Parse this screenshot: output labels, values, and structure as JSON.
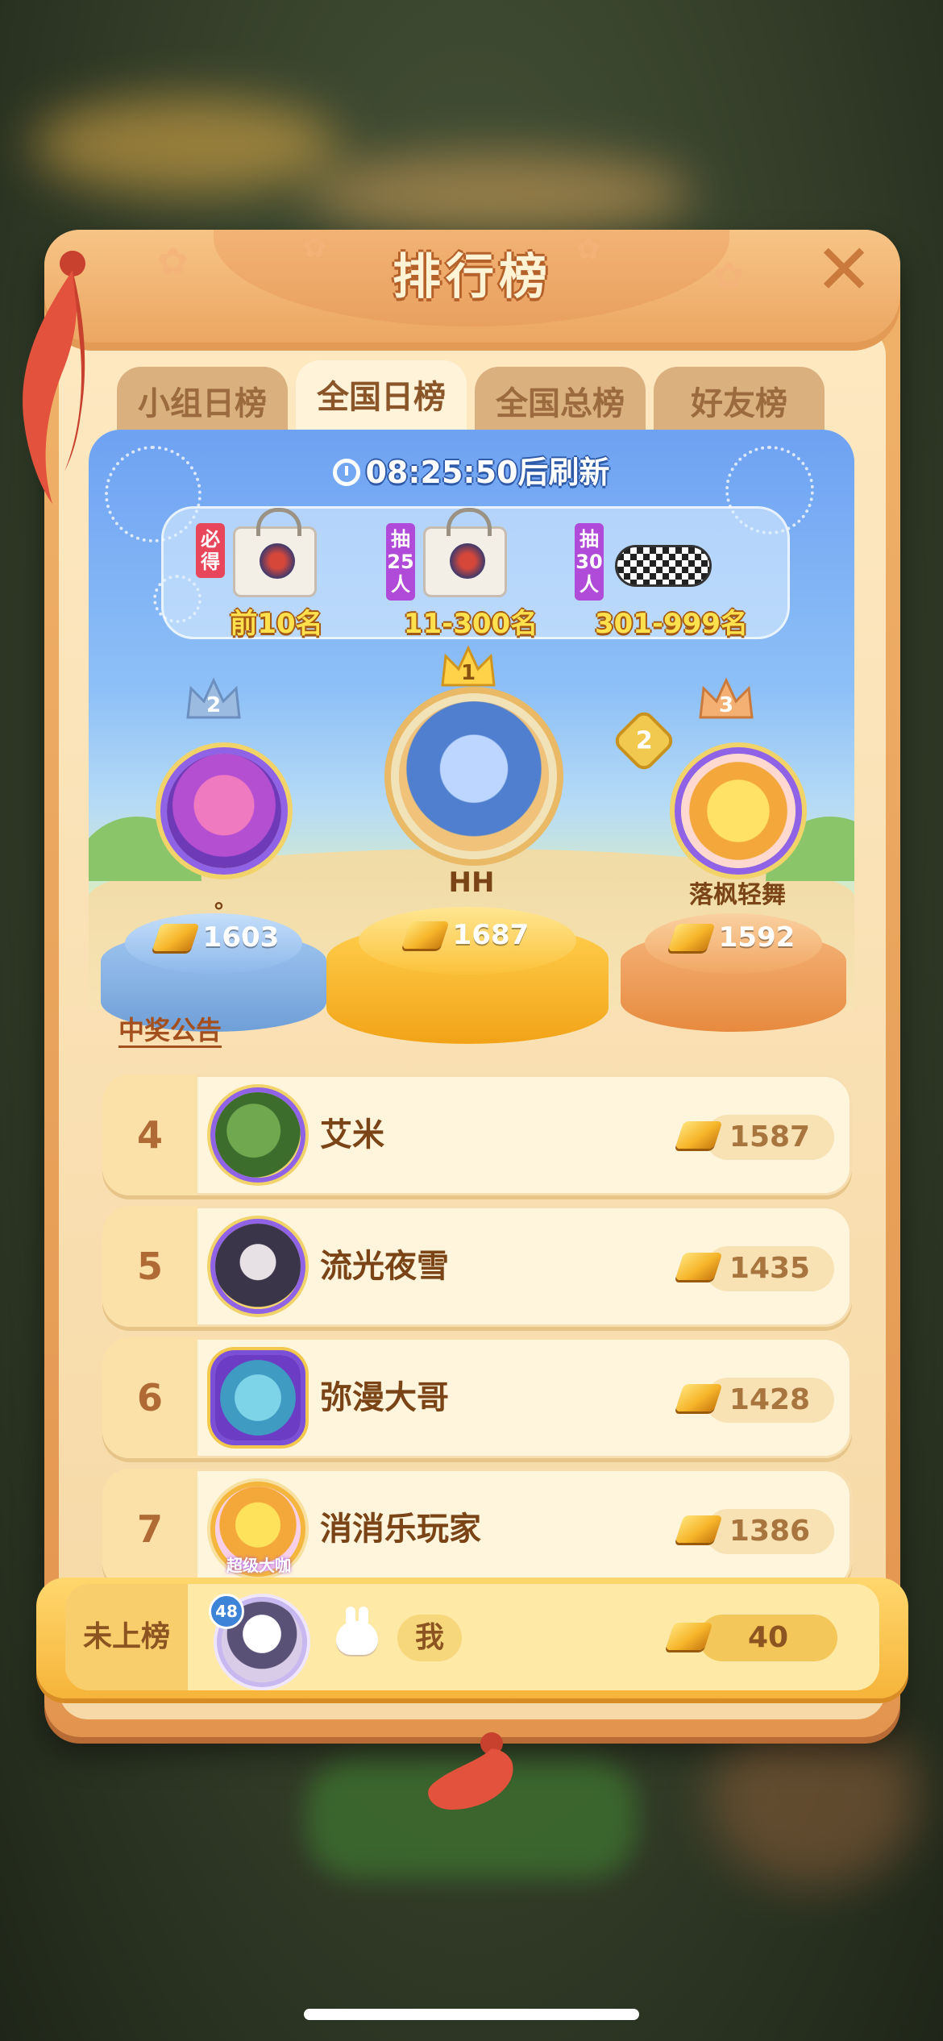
{
  "panel": {
    "title": "排行榜",
    "close_icon": "close-icon"
  },
  "tabs": [
    {
      "label": "小组日榜",
      "active": false
    },
    {
      "label": "全国日榜",
      "active": true
    },
    {
      "label": "全国总榜",
      "active": false
    },
    {
      "label": "好友榜",
      "active": false
    }
  ],
  "refresh": {
    "countdown": "08:25:50",
    "suffix": "后刷新"
  },
  "prizes": [
    {
      "tag": "必得",
      "range": "前10名",
      "item": "tote-bag",
      "tag_color": "#e8475b"
    },
    {
      "tag": "抽25人",
      "range": "11-300名",
      "item": "tote-bag",
      "tag_color": "#b04ad8"
    },
    {
      "tag": "抽30人",
      "range": "301-999名",
      "item": "checkered-belt-bag",
      "tag_color": "#b04ad8"
    }
  ],
  "podium": [
    {
      "rank": "1",
      "name": "HH",
      "score": "1687",
      "color": "#f5b42c"
    },
    {
      "rank": "2",
      "name": "。",
      "score": "1603",
      "color": "#7fb2e8"
    },
    {
      "rank": "3",
      "name": "落枫轻舞",
      "score": "1592",
      "color": "#f0a55c",
      "level_badge": "2"
    }
  ],
  "announcement": "中奖公告",
  "list": [
    {
      "rank": "4",
      "name": "艾米",
      "score": "1587"
    },
    {
      "rank": "5",
      "name": "流光夜雪",
      "score": "1435"
    },
    {
      "rank": "6",
      "name": "弥漫大哥",
      "score": "1428"
    },
    {
      "rank": "7",
      "name": "消消乐玩家",
      "score": "1386",
      "avatar_caption": "超级大咖"
    }
  ],
  "self": {
    "rank": "未上榜",
    "level": "48",
    "name": "我",
    "score": "40"
  },
  "colors": {
    "panel_orange": "#e3954f",
    "gold": "#f6b52a",
    "brown_text": "#7a4416"
  }
}
